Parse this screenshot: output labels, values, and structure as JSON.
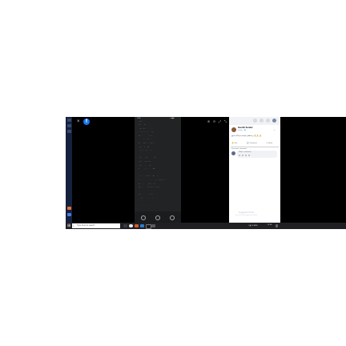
{
  "viewer": {
    "close_glyph": "×",
    "brand_glyph": "f",
    "tools": [
      "⊕",
      "⊖",
      "⤢",
      "⤡"
    ]
  },
  "phone": {
    "status_time": "11:36",
    "status_icons": "▲ ◼ ▮",
    "header": "Vijayalakshmi",
    "lines": [
      "ஸ்ரீராம ஜெயம் ராம ராம ராம",
      "ஜெய ஜெய ராமா ராம ராம",
      "ஓம் நமோ நாராயணாய நம",
      "ஸ்ரீ வேங்கடேச சுப்ரபாதம்",
      "கௌசல்யா சுப்ரஜா ராம",
      "பூர்வா சந்த்யா ப்ரவர்த்ததே",
      "உத்திஷ்ட நரசார்தூல",
      "கர்தவ்யம் தைவமாஹ்நிகம்",
      "",
      "உத்திஷ்டோத்திஷ்ட கோவிந்த",
      "உத்திஷ்ட கருடத்வஜ",
      "உத்திஷ்ட கமலாகாந்த",
      "த்ரைலோக்யம் மங்களம் குரு",
      "",
      "மாதஸ்ஸமஸ்த ஜகதாம் மதுகைடபாரே:",
      "வக்ஷோவிஹாரிணி மனோஹர திவ்யமூர்த்தே",
      "ஸ்ரீஸ்வாமினி ச்ரிதஜனப்ரியதான சீலே",
      "ஸ்ரீ வேங்கடேச தயிதே தவ சுப்ரபாதம்",
      "",
      "ஸ்ரீ வேங்கடேச சுப்ரபாதம்",
      "ஓம் நமோ வேங்கடேசாய",
      "",
      "ராம ராம ராம ராம ❤"
    ]
  },
  "panel": {
    "author": "Keerthi Sundar",
    "meta": "1 hour · 🌐",
    "caption": "ஓம் நமோ நாராயணாய 🙏🙏🙏",
    "actions": [
      "👍 Like",
      "💬 Comment",
      "↪ Share"
    ],
    "view_comments": "View more comments",
    "comment_placeholder": "Write a comment...",
    "footer_title": "Suggested Posts",
    "footer_sub": "Here you'll find suggested content"
  },
  "taskbar": {
    "start_glyph": "⊞",
    "search_placeholder": "Type here to search",
    "search_glyph": "⌕",
    "tray_text": "^ ◧ ⊡ ENG",
    "clock": "11:36"
  },
  "colors": {
    "accent": "#1877f2",
    "taskbar": "#1f1f24"
  }
}
